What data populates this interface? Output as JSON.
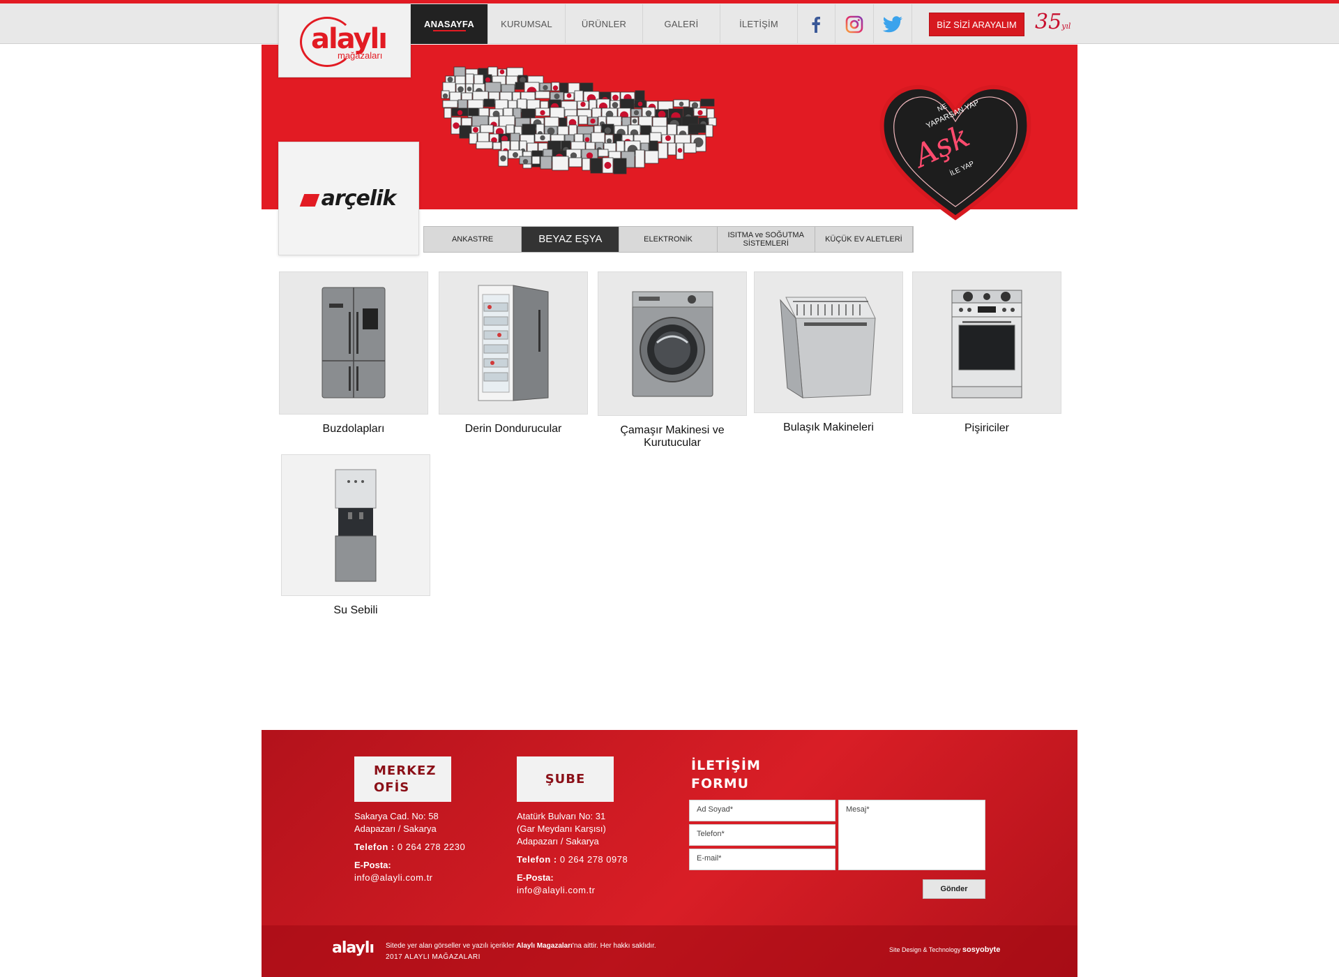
{
  "header": {
    "logo_text": "alaylı",
    "logo_sub": "mağazaları",
    "nav": [
      {
        "label": "ANASAYFA",
        "active": true
      },
      {
        "label": "KURUMSAL",
        "active": false
      },
      {
        "label": "ÜRÜNLER",
        "active": false
      },
      {
        "label": "GALERİ",
        "active": false
      },
      {
        "label": "İLETİŞİM",
        "active": false
      }
    ],
    "social": [
      "facebook-icon",
      "instagram-icon",
      "twitter-icon"
    ],
    "call_button": "BİZ SİZİ ARAYALIM",
    "years": "35",
    "years_sub": "yıl"
  },
  "hero": {
    "heart_lines": [
      "NE",
      "YAPARSAN YAP",
      "Aşk",
      "İLE YAP"
    ]
  },
  "brand": {
    "name": "arçelik"
  },
  "category_tabs": [
    {
      "label": "ANKASTRE",
      "active": false
    },
    {
      "label": "BEYAZ EŞYA",
      "active": true
    },
    {
      "label": "ELEKTRONİK",
      "active": false
    },
    {
      "label": "ISITMA ve SOĞUTMA SİSTEMLERİ",
      "active": false
    },
    {
      "label": "KÜÇÜK EV ALETLERİ",
      "active": false
    }
  ],
  "products": [
    {
      "label": "Buzdolapları",
      "icon": "refrigerator-icon"
    },
    {
      "label": "Derin Dondurucular",
      "icon": "freezer-icon"
    },
    {
      "label": "Çamaşır Makinesi ve Kurutucular",
      "icon": "washing-machine-icon"
    },
    {
      "label": "Bulaşık Makineleri",
      "icon": "dishwasher-icon"
    },
    {
      "label": "Pişiriciler",
      "icon": "cooker-icon"
    },
    {
      "label": "Su Sebili",
      "icon": "water-dispenser-icon"
    }
  ],
  "footer": {
    "merkez": {
      "title": "MERKEZ OFİS",
      "address1": "Sakarya Cad. No: 58",
      "address2": "Adapazarı / Sakarya",
      "phone_label": "Telefon :",
      "phone": "0 264 278 2230",
      "email_label": "E-Posta:",
      "email": "info@alayli.com.tr"
    },
    "sube": {
      "title": "ŞUBE",
      "address1": "Atatürk Bulvarı No: 31",
      "address2": "(Gar Meydanı Karşısı)",
      "address3": "Adapazarı / Sakarya",
      "phone_label": "Telefon :",
      "phone": "0 264 278 0978",
      "email_label": "E-Posta:",
      "email": "info@alayli.com.tr"
    },
    "form": {
      "title_line1": "İLETİŞİM",
      "title_line2": "FORMU",
      "name_placeholder": "Ad Soyad*",
      "phone_placeholder": "Telefon*",
      "email_placeholder": "E-mail*",
      "message_placeholder": "Mesaj*",
      "submit": "Gönder"
    },
    "copyright_pre": "Sitede yer alan görseller ve yazılı içerikler",
    "copyright_brand": "Alaylı Magazaları",
    "copyright_post": "'na aittir. Her hakkı saklıdır.",
    "copyright_year": "2017 ALAYLI MAĞAZALARI",
    "mini_logo": "alaylı",
    "credit_text": "Site Design & Technology",
    "credit_brand": "sosyobyte"
  },
  "colors": {
    "brand_red": "#e21b23",
    "dark": "#222222"
  }
}
